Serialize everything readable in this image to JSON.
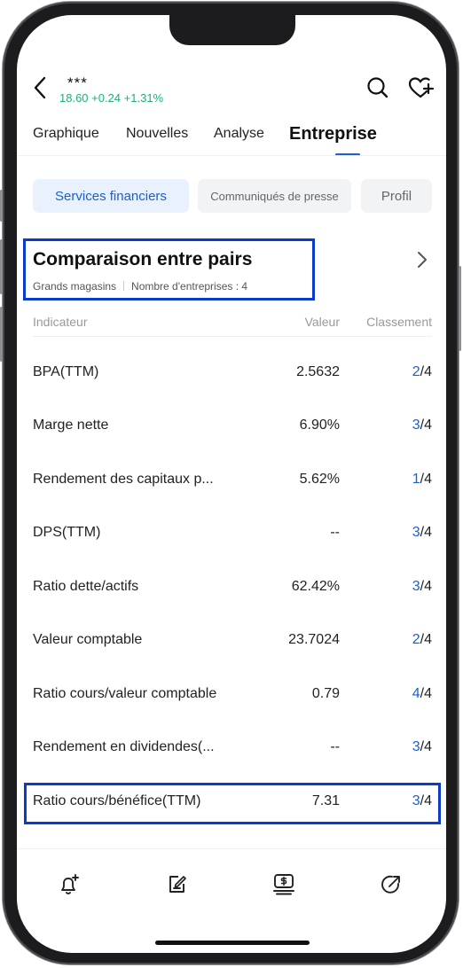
{
  "header": {
    "ticker": "***",
    "price_line": "18.60 +0.24 +1.31%"
  },
  "tabs": [
    {
      "label": "Graphique"
    },
    {
      "label": "Nouvelles"
    },
    {
      "label": "Analyse"
    },
    {
      "label": "Entreprise"
    }
  ],
  "chips": [
    {
      "label": "Services financiers"
    },
    {
      "label": "Communiqués de presse"
    },
    {
      "label": "Profil"
    }
  ],
  "section": {
    "title": "Comparaison entre pairs",
    "category": "Grands magasins",
    "company_count": "Nombre d'entreprises : 4"
  },
  "table": {
    "headers": {
      "indicator": "Indicateur",
      "value": "Valeur",
      "rank": "Classement"
    },
    "rows": [
      {
        "name": "BPA(TTM)",
        "value": "2.5632",
        "rank": "2",
        "total": "/4"
      },
      {
        "name": "Marge nette",
        "value": "6.90%",
        "rank": "3",
        "total": "/4"
      },
      {
        "name": "Rendement des capitaux p...",
        "value": "5.62%",
        "rank": "1",
        "total": "/4"
      },
      {
        "name": "DPS(TTM)",
        "value": "--",
        "rank": "3",
        "total": "/4"
      },
      {
        "name": "Ratio dette/actifs",
        "value": "62.42%",
        "rank": "3",
        "total": "/4"
      },
      {
        "name": "Valeur comptable",
        "value": "23.7024",
        "rank": "2",
        "total": "/4"
      },
      {
        "name": "Ratio cours/valeur comptable",
        "value": "0.79",
        "rank": "4",
        "total": "/4"
      },
      {
        "name": "Rendement en dividendes(...",
        "value": "--",
        "rank": "3",
        "total": "/4"
      },
      {
        "name": "Ratio cours/bénéfice(TTM)",
        "value": "7.31",
        "rank": "3",
        "total": "/4"
      }
    ]
  },
  "colors": {
    "accent": "#1a5fd6",
    "positive": "#1bb07c",
    "highlight_box": "#0a3cc9"
  }
}
